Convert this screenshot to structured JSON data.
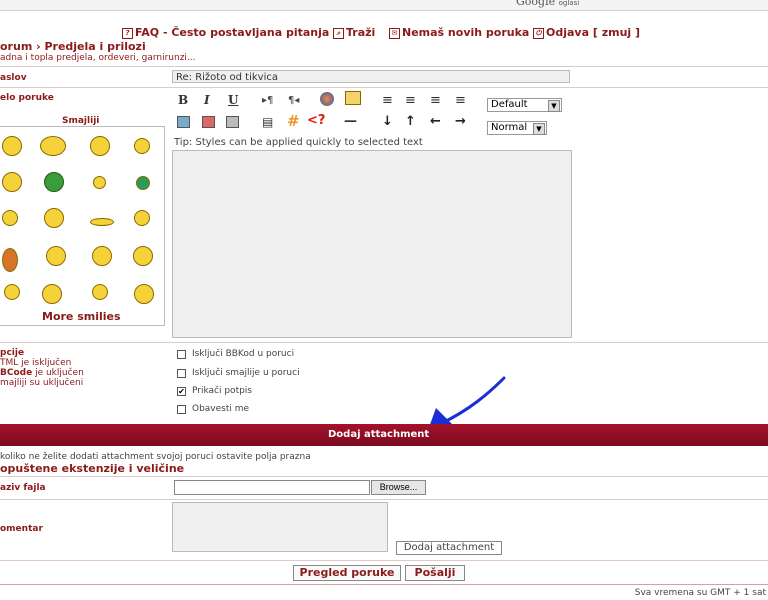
{
  "header": {
    "google_text": "Google",
    "google_suffix": "oglasi"
  },
  "nav": {
    "faq": "FAQ - Često postavljana pitanja",
    "search": "Traži",
    "messages": "Nemaš novih poruka",
    "logout": "Odjava [ zmuj ]"
  },
  "breadcrumb": {
    "trail": "orum › Predjela i prilozi",
    "description": "adna i topla predjela, ordeveri, garnirunzi..."
  },
  "form": {
    "subject_label": "aslov",
    "subject_value": "Re: Rižoto od tikvica",
    "body_label": "elo poruke",
    "smilies_title": "Smajliji",
    "more_smilies": "More smilies",
    "font_select": "Default",
    "size_select": "Normal",
    "tip": "Tip: Styles can be applied quickly to selected text",
    "toolbar": {
      "bold": "B",
      "italic": "I",
      "underline": "U",
      "color": "#",
      "quote": "<?"
    }
  },
  "options": {
    "title": "pcije",
    "html": "TML je isključen",
    "bbcode_bold": "BCode",
    "bbcode_rest": " je uključen",
    "smilies": "majliji su uključeni",
    "checkboxes": [
      {
        "label": "Isključi BBKod u poruci",
        "checked": false
      },
      {
        "label": "Isključi smajlije u poruci",
        "checked": false
      },
      {
        "label": "Prikači potpis",
        "checked": true
      },
      {
        "label": "Obavesti me",
        "checked": false
      }
    ]
  },
  "attachment": {
    "bar_title": "Dodaj attachment",
    "note": "koliko ne želite dodati attachment svojoj poruci ostavite polja prazna",
    "extensions": "opuštene ekstenzije i veličine",
    "file_label": "aziv fajla",
    "browse_label": "Browse...",
    "comment_label": "omentar",
    "add_button": "Dodaj attachment"
  },
  "actions": {
    "preview": "Pregled poruke",
    "send": "Pošalji"
  },
  "footer": {
    "timezone": "Sva vremena su GMT + 1 sat"
  },
  "colors": {
    "accent": "#8b1a1a",
    "bar": "#9a1027",
    "annotation_arrow": "#1a2fd6"
  }
}
